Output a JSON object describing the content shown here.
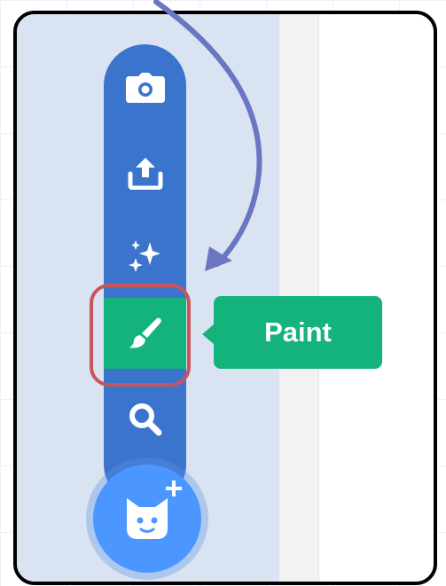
{
  "menu": {
    "buttons": [
      {
        "name": "choose-costume-camera",
        "icon": "camera-icon"
      },
      {
        "name": "upload-costume",
        "icon": "upload-icon"
      },
      {
        "name": "surprise",
        "icon": "sparkles-icon"
      },
      {
        "name": "paint",
        "icon": "paintbrush-icon"
      },
      {
        "name": "choose-costume",
        "icon": "search-icon"
      }
    ],
    "main_button_icon": "cat-icon",
    "main_button_badge_icon": "plus-icon"
  },
  "tooltip": {
    "label": "Paint"
  },
  "colors": {
    "menu_bar": "#3b74cc",
    "active_button": "#14b37c",
    "tooltip": "#14b37c",
    "main_button": "#4c97ff",
    "highlight_outline": "#c9545c",
    "annotation_arrow": "#6a76c2",
    "panel_background": "#d9e3f2"
  }
}
